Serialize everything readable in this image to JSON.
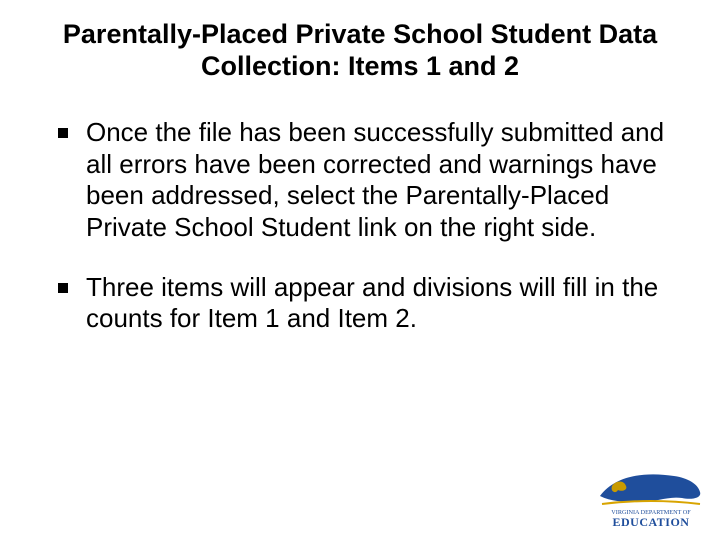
{
  "title": "Parentally-Placed Private School Student Data Collection: Items 1 and 2",
  "bullets": [
    "Once the file has been successfully submitted and all errors have been corrected and warnings have been addressed, select the Parentally-Placed Private School Student link on the right side.",
    "Three items will appear and divisions will fill in the counts for Item 1 and Item 2."
  ],
  "logo": {
    "primary_text": "VIRGINIA DEPARTMENT OF",
    "main_text": "EDUCATION",
    "shape_color": "#1f4e9c",
    "accent_color": "#d8a400"
  }
}
